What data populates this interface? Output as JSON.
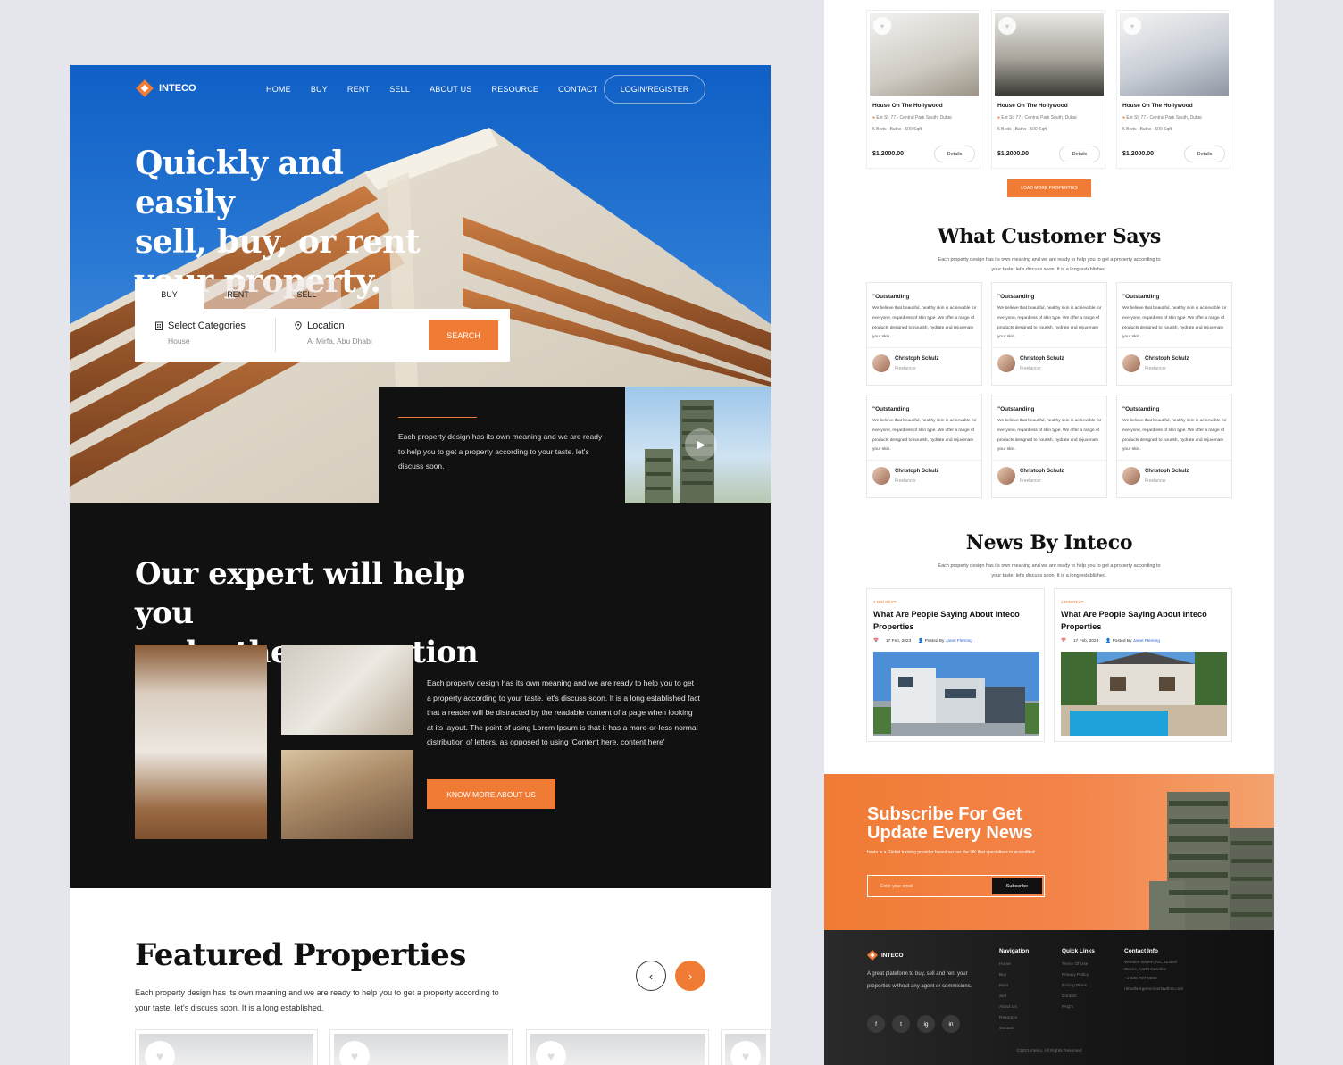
{
  "brand": "INTECO",
  "colors": {
    "accent": "#f07b34",
    "dark": "#111111",
    "hero_sky": "#0f5fc6"
  },
  "nav": {
    "links": [
      "HOME",
      "BUY",
      "RENT",
      "SELL",
      "ABOUT US",
      "RESOURCE",
      "CONTACT"
    ],
    "login": "LOGIN/REGISTER"
  },
  "hero": {
    "title_lines": [
      "Quickly and easily",
      "sell, buy, or rent",
      "your property."
    ],
    "tabs": [
      "BUY",
      "RENT",
      "SELL"
    ],
    "category_label": "Select Categories",
    "category_value": "House",
    "location_label": "Location",
    "location_value": "Al Mirfa, Abu Dhabi",
    "search_button": "SEARCH",
    "blurb": "Each property design has its own meaning and we are ready to help you to get a property according to your taste. let's discuss soon."
  },
  "renovation": {
    "title_lines": [
      "Our expert will help you",
      "make the renovation"
    ],
    "text": "Each property design has its own meaning and we are ready to help you to get a property according to your taste. let's discuss soon. It is a long established fact that a reader will be distracted by the readable content of a page when looking at its layout. The point of using Lorem Ipsum is that it has a more-or-less normal distribution of letters, as opposed to using 'Content here, content here'",
    "button": "KNOW MORE ABOUT US"
  },
  "featured": {
    "title": "Featured Properties",
    "text": "Each property design has its own meaning and we are ready to help you to get a property according to your taste. let's discuss soon. It is a long established."
  },
  "properties": [
    {
      "title": "House On The Hollywood",
      "address": "Est St. 77 - Central Park South, Dubai",
      "beds": "5 Beds",
      "baths": "Baths",
      "area": "500 Sqft",
      "price": "$1,2000.00",
      "button": "Details"
    },
    {
      "title": "House On The Hollywood",
      "address": "Est St. 77 - Central Park South, Dubai",
      "beds": "5 Beds",
      "baths": "Baths",
      "area": "500 Sqft",
      "price": "$1,2000.00",
      "button": "Details"
    },
    {
      "title": "House On The Hollywood",
      "address": "Est St. 77 - Central Park South, Dubai",
      "beds": "5 Beds",
      "baths": "Baths",
      "area": "500 Sqft",
      "price": "$1,2000.00",
      "button": "Details"
    }
  ],
  "load_more": "LOAD MORE PROPERTIES",
  "testimonials": {
    "title": "What Customer Says",
    "subtitle": "Each property design has its own meaning and we are ready to help you to get a property according to your taste. let's discuss soon. It is a long established.",
    "items": [
      {
        "quote": "\"Outstanding",
        "text": "We believe that beautiful, healthy skin is achievable for everyone, regardless of skin type. We offer a range of products designed to nourish, hydrate and rejuvenate your skin.",
        "name": "Christoph Schulz",
        "role": "Freelancer"
      },
      {
        "quote": "\"Outstanding",
        "text": "We believe that beautiful, healthy skin is achievable for everyone, regardless of skin type. We offer a range of products designed to nourish, hydrate and rejuvenate your skin.",
        "name": "Christoph Schulz",
        "role": "Freelancer"
      },
      {
        "quote": "\"Outstanding",
        "text": "We believe that beautiful, healthy skin is achievable for everyone, regardless of skin type. We offer a range of products designed to nourish, hydrate and rejuvenate your skin.",
        "name": "Christoph Schulz",
        "role": "Freelancer"
      },
      {
        "quote": "\"Outstanding",
        "text": "We believe that beautiful, healthy skin is achievable for everyone, regardless of skin type. We offer a range of products designed to nourish, hydrate and rejuvenate your skin.",
        "name": "Christoph Schulz",
        "role": "Freelancer"
      },
      {
        "quote": "\"Outstanding",
        "text": "We believe that beautiful, healthy skin is achievable for everyone, regardless of skin type. We offer a range of products designed to nourish, hydrate and rejuvenate your skin.",
        "name": "Christoph Schulz",
        "role": "Freelancer"
      },
      {
        "quote": "\"Outstanding",
        "text": "We believe that beautiful, healthy skin is achievable for everyone, regardless of skin type. We offer a range of products designed to nourish, hydrate and rejuvenate your skin.",
        "name": "Christoph Schulz",
        "role": "Freelancer"
      }
    ]
  },
  "news": {
    "title": "News By Inteco",
    "subtitle": "Each property design has its own meaning and we are ready to help you to get a property according to your taste. let's discuss soon. It is a long established.",
    "items": [
      {
        "read_time": "2 MIN READ",
        "title": "What Are People Saying About Inteco Properties",
        "date": "17 Feb, 2023",
        "posted_by": "Posted By",
        "author": "Janet Fleming"
      },
      {
        "read_time": "2 MIN READ",
        "title": "What Are People Saying About Inteco Properties",
        "date": "17 Feb, 2023",
        "posted_by": "Posted By",
        "author": "Janet Fleming"
      }
    ]
  },
  "subscribe": {
    "title_lines": [
      "Subscribe For Get",
      "Update Every News"
    ],
    "text": "hosto is a Global training provider based across the UK that specialises in accredited",
    "placeholder": "Enter your email",
    "button": "Subscribe"
  },
  "footer": {
    "brand": "INTECO",
    "desc": "A great plateform to buy, sell and rent your properties without any agent or commisions.",
    "social": [
      "f",
      "t",
      "ig",
      "in"
    ],
    "social_icons": [
      "facebook-icon",
      "twitter-icon",
      "instagram-icon",
      "linkedin-icon"
    ],
    "navigation": {
      "title": "Navigation",
      "items": [
        "Home",
        "Buy",
        "Rent",
        "Sell",
        "About Us",
        "Resource",
        "Contact"
      ]
    },
    "quick_links": {
      "title": "Quick Links",
      "items": [
        "Terms Of Use",
        "Privacy Policy",
        "Pricing Plans",
        "Contact",
        "FAQ's"
      ]
    },
    "contact": {
      "title": "Contact Info",
      "items": [
        "Winston-Salem, NC, United",
        "States, North Carolina",
        "+1 336-727-0888",
        "ritmalloergemcriverlawfirm.com"
      ]
    },
    "copyright": "©2021 Inteco. All Rights Reserved"
  }
}
